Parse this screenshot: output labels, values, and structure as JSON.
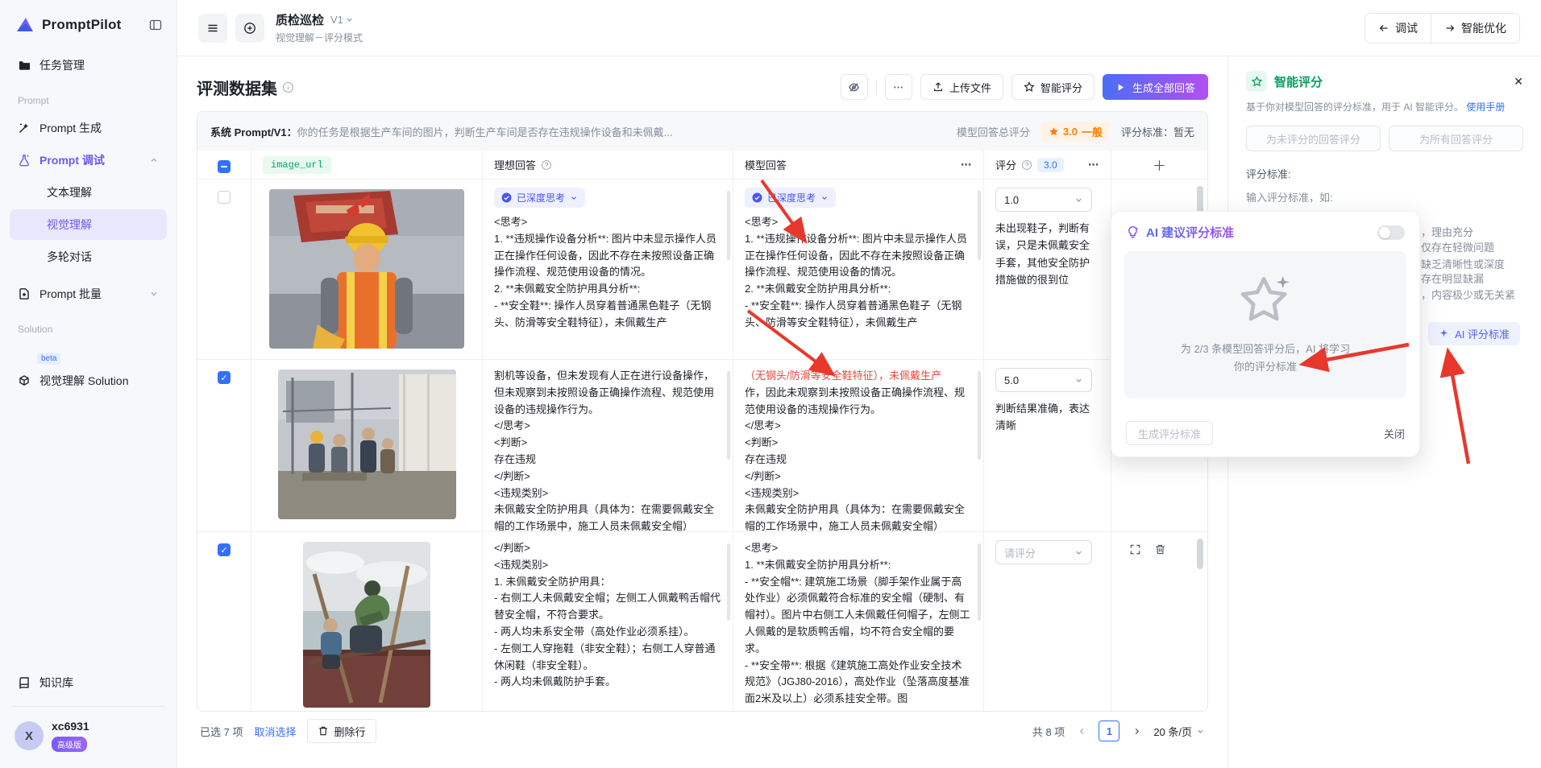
{
  "app": {
    "name": "PromptPilot"
  },
  "sidebar": {
    "nav_task": "任务管理",
    "section_prompt": "Prompt",
    "nav_generate": "Prompt 生成",
    "nav_debug": "Prompt 调试",
    "sub_text": "文本理解",
    "sub_vision": "视觉理解",
    "sub_multi": "多轮对话",
    "nav_batch": "Prompt 批量",
    "section_solution": "Solution",
    "solution_badge": "beta",
    "nav_solution": "视觉理解 Solution",
    "nav_kb": "知识库",
    "user_avatar": "X",
    "user_name": "xc6931",
    "user_badge": "高级版"
  },
  "header": {
    "title": "质检巡检",
    "version": "V1",
    "subtitle": "视觉理解－评分模式",
    "debug_button": "调试",
    "optimize_button": "智能优化"
  },
  "dataset": {
    "title": "评测数据集",
    "upload_button": "上传文件",
    "smart_score_button": "智能评分",
    "generate_all_button": "生成全部回答"
  },
  "system_bar": {
    "label": "系统 Prompt/V1：",
    "text": "你的任务是根据生产车间的图片，判断生产车间是否存在违规操作设备和未佩戴...",
    "total_label": "模型回答总评分",
    "score": "3.0",
    "score_level": "一般",
    "criteria_label": "评分标准：",
    "criteria_value": "暂无"
  },
  "table": {
    "headers": {
      "image": "image_url",
      "ideal": "理想回答",
      "model": "模型回答",
      "score": "评分",
      "score_avg": "3.0"
    },
    "think_badge": "已深度思考",
    "rows": [
      {
        "ideal_text": "<思考>\n1. **违规操作设备分析**: 图片中未显示操作人员正在操作任何设备，因此不存在未按照设备正确操作流程、规范使用设备的情况。\n2. **未佩戴安全防护用具分析**:\n- **安全鞋**: 操作人员穿着普通黑色鞋子（无钢头、防滑等安全鞋特征），未佩戴生产",
        "model_text": "<思考>\n1. **违规操作设备分析**: 图片中未显示操作人员正在操作任何设备，因此不存在未按照设备正确操作流程、规范使用设备的情况。\n2. **未佩戴安全防护用具分析**:\n- **安全鞋**: 操作人员穿着普通黑色鞋子（无钢头、防滑等安全鞋特征），未佩戴生产",
        "score": "1.0",
        "comment": "未出现鞋子，判断有误，只是未佩戴安全手套，其他安全防护措施做的很到位"
      },
      {
        "ideal_text": "割机等设备，但未发现有人正在进行设备操作，但未观察到未按照设备正确操作流程、规范使用设备的违规操作行为。\n</思考>\n<判断>\n存在违规\n</判断>\n<违规类别>\n未佩戴安全防护用具（具体为：在需要佩戴安全帽的工作场景中，施工人员未佩戴安全帽）",
        "model_highlight": "（无钢头/防滑等安全鞋特征），未佩戴生产",
        "model_text": "作，因此未观察到未按照设备正确操作流程、规范使用设备的违规操作行为。\n</思考>\n<判断>\n存在违规\n</判断>\n<违规类别>\n未佩戴安全防护用具（具体为：在需要佩戴安全帽的工作场景中，施工人员未佩戴安全帽）",
        "score": "5.0",
        "comment": "判断结果准确，表达清晰"
      },
      {
        "ideal_text": "</判断>\n<违规类别>\n1. 未佩戴安全防护用具：\n- 右侧工人未佩戴安全帽；左侧工人佩戴鸭舌帽代替安全帽，不符合要求。\n- 两人均未系安全带（高处作业必须系挂）。\n- 左侧工人穿拖鞋（非安全鞋）；右侧工人穿普通休闲鞋（非安全鞋）。\n- 两人均未佩戴防护手套。",
        "model_text": "<思考>\n1. **未佩戴安全防护用具分析**:\n- **安全帽**: 建筑施工场景（脚手架作业属于高处作业）必须佩戴符合标准的安全帽（硬制、有帽衬）。图片中右侧工人未佩戴任何帽子，左侧工人佩戴的是软质鸭舌帽，均不符合安全帽的要求。\n- **安全带**: 根据《建筑施工高处作业安全技术规范》（JGJ80-2016），高处作业（坠落高度基准面2米及以上）必须系挂安全带。图",
        "score_placeholder": "请评分"
      }
    ]
  },
  "bottombar": {
    "selected": "已选 7 项",
    "cancel": "取消选择",
    "delete_row": "删除行",
    "total": "共 8 项",
    "page": "1",
    "page_size": "20 条/页"
  },
  "right_panel": {
    "title": "智能评分",
    "subtitle": "基于你对模型回答的评分标准，用于 AI 智能评分。",
    "manual_link": "使用手册",
    "btn_score_unscored": "为未评分的回答评分",
    "btn_score_all": "为所有回答评分",
    "criteria_label": "评分标准:",
    "criteria_intro": "输入评分标准，如:",
    "criteria_fragments": [
      "，理由充分",
      "仅存在轻微问题",
      "缺乏清晰性或深度",
      "存在明显缺漏",
      "，内容极少或无关紧"
    ],
    "ai_criteria_button": "AI 评分标准"
  },
  "ai_card": {
    "title": "AI 建议评分标准",
    "caption": "为 2/3 条模型回答评分后，AI 将学习\n你的评分标准",
    "generate_button": "生成评分标准",
    "close_button": "关闭"
  },
  "colors": {
    "accent_purple": "#6a5cf0",
    "accent_blue": "#3370ff",
    "accent_green": "#0aa05e",
    "accent_orange": "#ff7d00",
    "gradient_button": "linear-gradient(90deg,#4a6ef5,#b44ef0)"
  }
}
